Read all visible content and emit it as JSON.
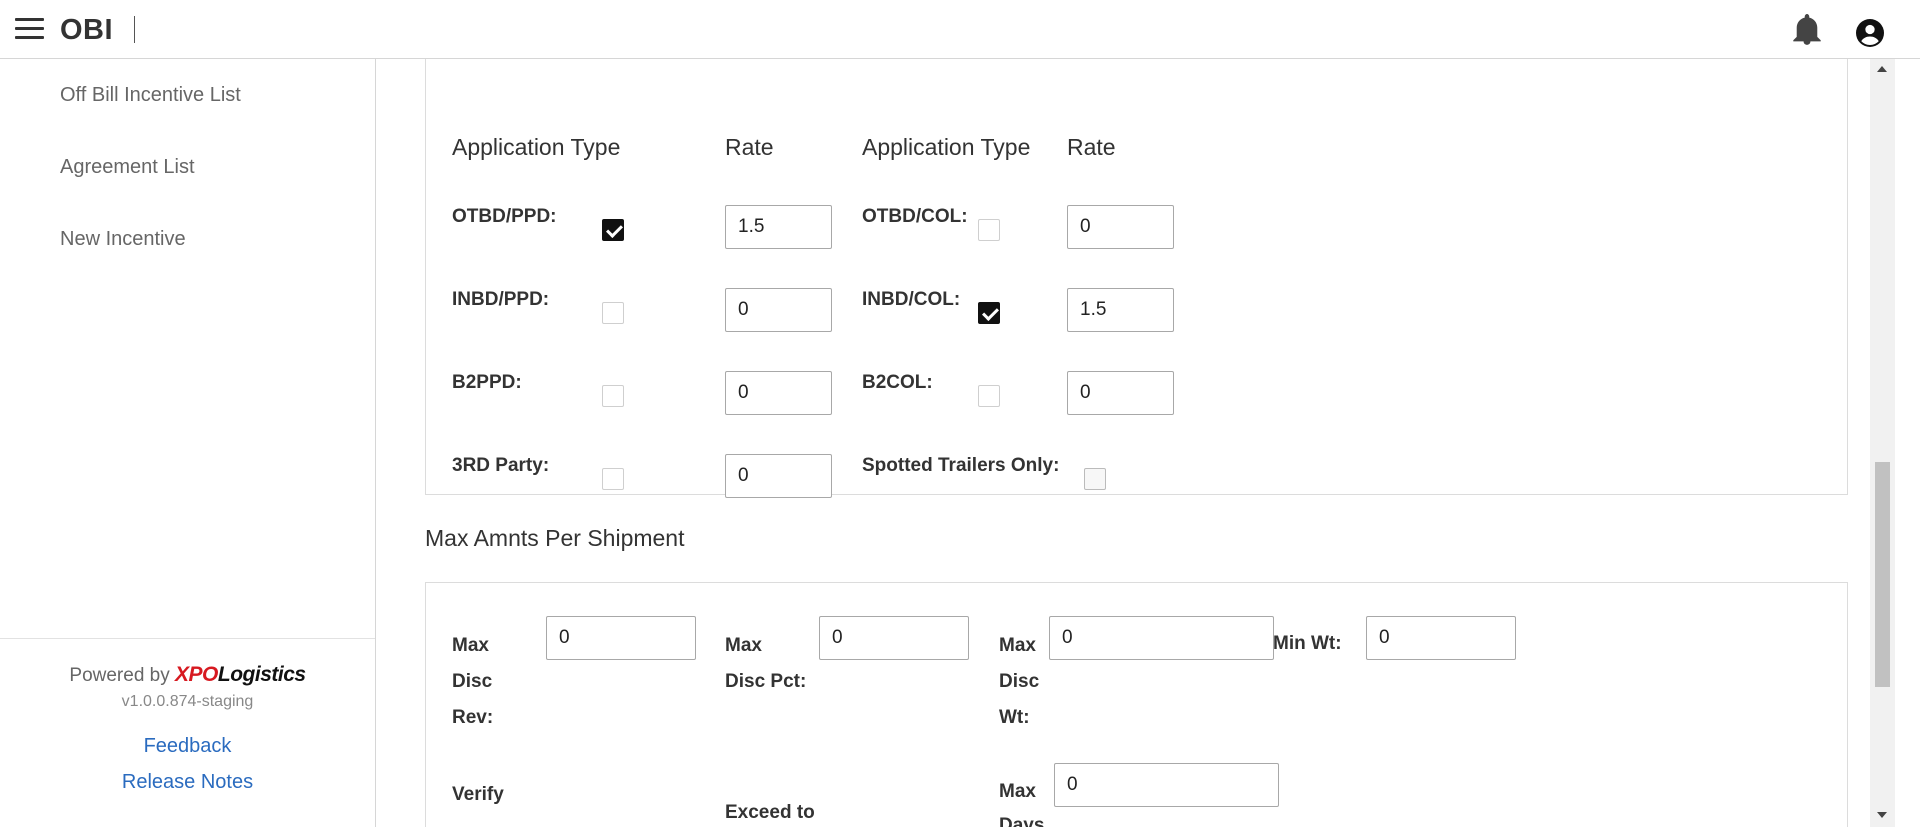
{
  "header": {
    "app_name": "OBI",
    "menu_icon": "hamburger-menu-icon",
    "notification_icon": "bell-icon",
    "account_icon": "account-circle-icon"
  },
  "sidebar": {
    "items": [
      {
        "label": "Off Bill Incentive List"
      },
      {
        "label": "Agreement List"
      },
      {
        "label": "New Incentive"
      }
    ],
    "footer": {
      "powered_by": "Powered by",
      "logo_xpo": "XPO",
      "logo_logistics": "Logistics",
      "version": "v1.0.0.874-staging",
      "feedback": "Feedback",
      "release_notes": "Release Notes"
    }
  },
  "application": {
    "headers": {
      "app_type_left": "Application Type",
      "rate_left": "Rate",
      "app_type_right": "Application Type",
      "rate_right": "Rate"
    },
    "left_rows": [
      {
        "label": "OTBD/PPD:",
        "checked": true,
        "rate": "1.5"
      },
      {
        "label": "INBD/PPD:",
        "checked": false,
        "rate": "0"
      },
      {
        "label": "B2PPD:",
        "checked": false,
        "rate": "0"
      },
      {
        "label": "3RD Party:",
        "checked": false,
        "rate": "0"
      }
    ],
    "right_rows": [
      {
        "label": "OTBD/COL:",
        "checked": false,
        "rate": "0"
      },
      {
        "label": "INBD/COL:",
        "checked": true,
        "rate": "1.5"
      },
      {
        "label": "B2COL:",
        "checked": false,
        "rate": "0"
      }
    ],
    "spotted_trailers": {
      "label": "Spotted Trailers Only:",
      "checked": false
    }
  },
  "max_amounts": {
    "title": "Max Amnts Per Shipment",
    "max_disc_rev": {
      "label_lines": [
        "Max",
        "Disc",
        "Rev:"
      ],
      "value": "0"
    },
    "max_disc_pct": {
      "label_lines": [
        "Max",
        "Disc Pct:"
      ],
      "value": "0"
    },
    "max_disc_wt": {
      "label_lines": [
        "Max",
        "Disc",
        "Wt:"
      ],
      "value": "0"
    },
    "min_wt": {
      "label": "Min Wt:",
      "value": "0"
    },
    "verify": {
      "label": "Verify"
    },
    "exceed_to": {
      "label": "Exceed to"
    },
    "max_days": {
      "label_lines": [
        "Max",
        "Days"
      ],
      "value": "0"
    }
  },
  "colors": {
    "link": "#2a6bbf",
    "xpo_red": "#d71920",
    "checkbox_checked": "#111111",
    "border": "#dcdcdc"
  }
}
